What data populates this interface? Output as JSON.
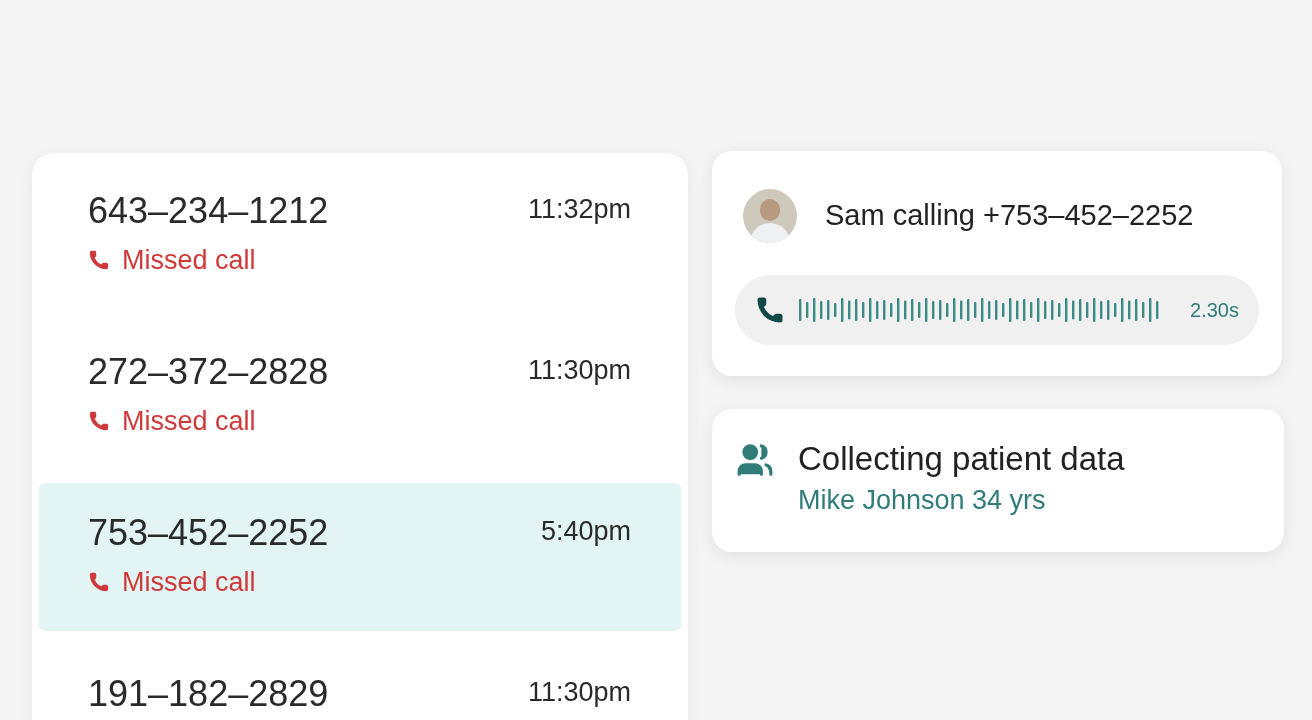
{
  "calls": [
    {
      "number": "643–234–1212",
      "status": "Missed call",
      "time": "11:32pm",
      "selected": false
    },
    {
      "number": "272–372–2828",
      "status": "Missed call",
      "time": "11:30pm",
      "selected": false
    },
    {
      "number": "753–452–2252",
      "status": "Missed call",
      "time": "5:40pm",
      "selected": true
    },
    {
      "number": "191–182–2829",
      "time": "11:30pm",
      "selected": false
    }
  ],
  "active_call": {
    "caller": "Sam calling +753–452–2252",
    "duration": "2.30s"
  },
  "task": {
    "title": "Collecting patient data",
    "subtitle": "Mike Johnson 34 yrs"
  }
}
